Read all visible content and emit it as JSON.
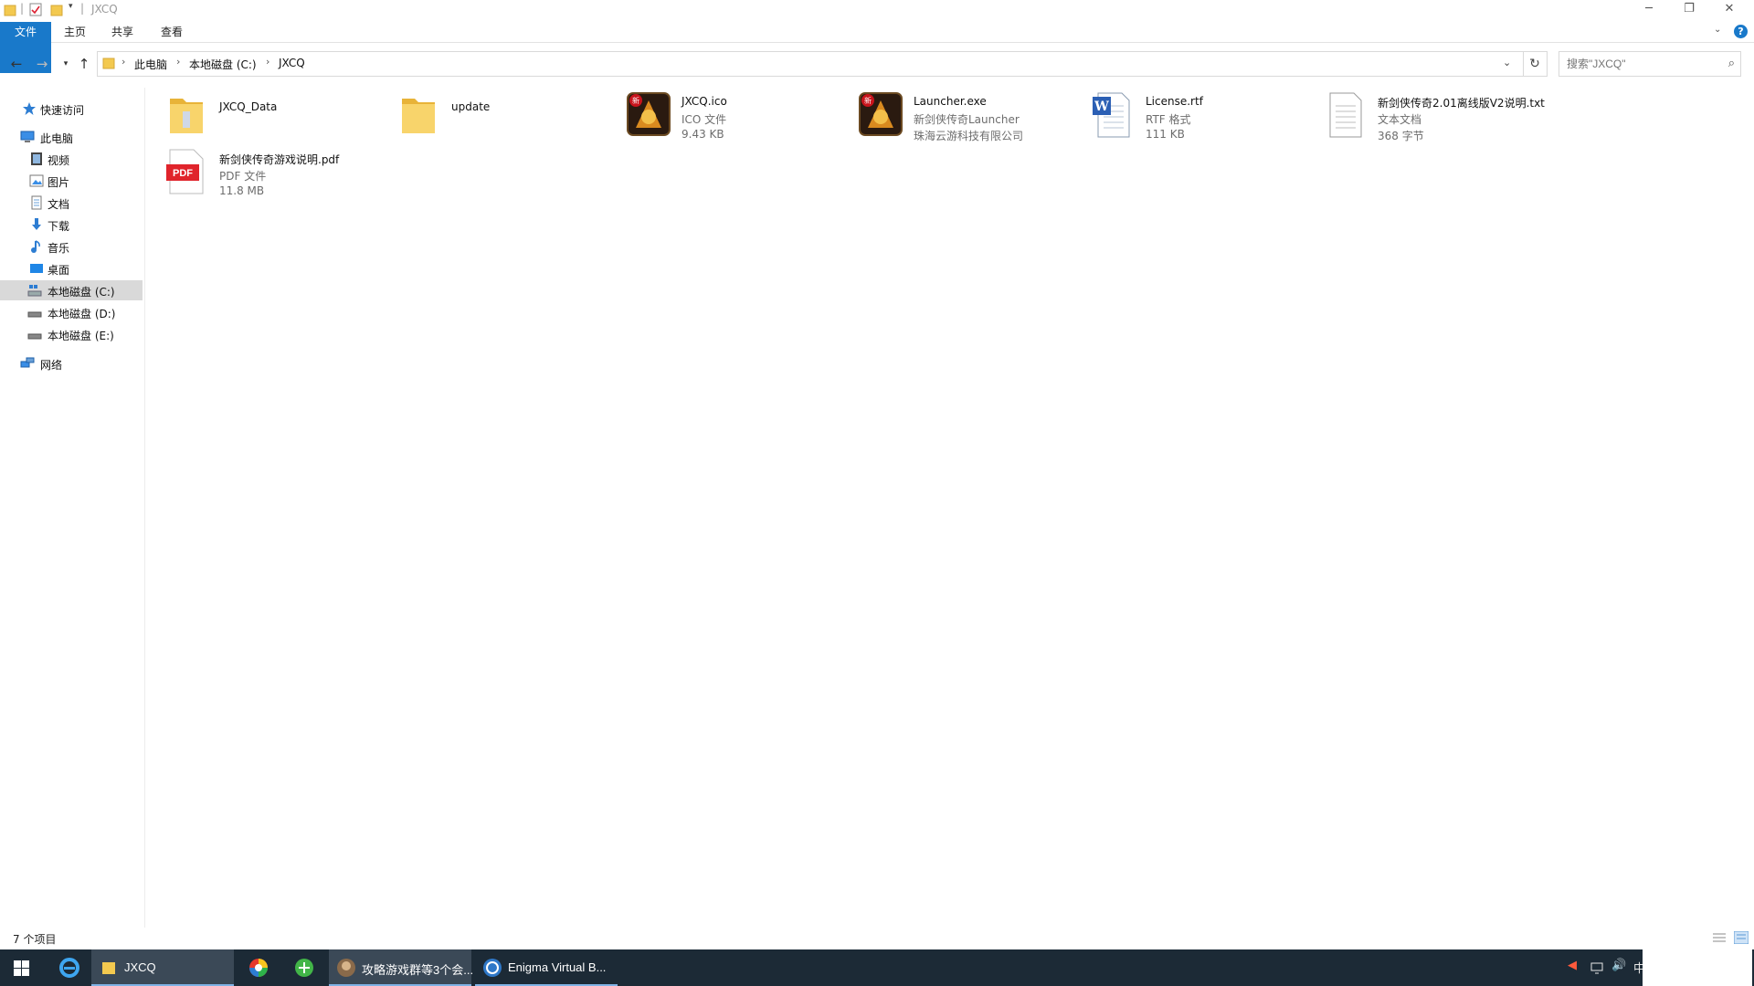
{
  "window": {
    "title": "JXCQ",
    "controls": {
      "minimize": "─",
      "restore": "❐",
      "close": "✕"
    }
  },
  "ribbon": {
    "tabs": [
      "文件",
      "主页",
      "共享",
      "查看"
    ],
    "help": "?"
  },
  "address_bar": {
    "crumbs": [
      "此电脑",
      "本地磁盘 (C:)",
      "JXCQ"
    ],
    "search_placeholder": "搜索\"JXCQ\""
  },
  "nav_pane": {
    "quick_access": "快速访问",
    "this_pc": "此电脑",
    "pc_items": [
      "视频",
      "图片",
      "文档",
      "下载",
      "音乐",
      "桌面",
      "本地磁盘 (C:)",
      "本地磁盘 (D:)",
      "本地磁盘 (E:)"
    ],
    "network": "网络",
    "selected": "本地磁盘 (C:)"
  },
  "files": [
    {
      "name": "JXCQ_Data",
      "line1": "",
      "line2": "",
      "icon": "folder-icon"
    },
    {
      "name": "update",
      "line1": "",
      "line2": "",
      "icon": "folder-icon"
    },
    {
      "name": "JXCQ.ico",
      "line1": "ICO 文件",
      "line2": "9.43 KB",
      "icon": "game-icon"
    },
    {
      "name": "Launcher.exe",
      "line1": "新剑侠传奇Launcher",
      "line2": "珠海云游科技有限公司",
      "icon": "game-icon"
    },
    {
      "name": "License.rtf",
      "line1": "RTF 格式",
      "line2": "111 KB",
      "icon": "word-doc-icon"
    },
    {
      "name": "新剑侠传奇2.01离线版V2说明.txt",
      "line1": "文本文档",
      "line2": "368 字节",
      "icon": "text-doc-icon"
    },
    {
      "name": "新剑侠传奇游戏说明.pdf",
      "line1": "PDF 文件",
      "line2": "11.8 MB",
      "icon": "pdf-icon"
    }
  ],
  "icon_badges": {
    "game": "新",
    "pdf": "PDF",
    "word": "W"
  },
  "status": {
    "count": "7 个项目"
  },
  "taskbar": {
    "explorer_label": "JXCQ",
    "app1_label": "攻略游戏群等3个会...",
    "app2_label": "Enigma Virtual B...",
    "ime": "中"
  },
  "colors": {
    "accent": "#1979ca",
    "taskbar": "#1c2a36",
    "folder": "#f3c94f",
    "pdf": "#e0242b"
  }
}
